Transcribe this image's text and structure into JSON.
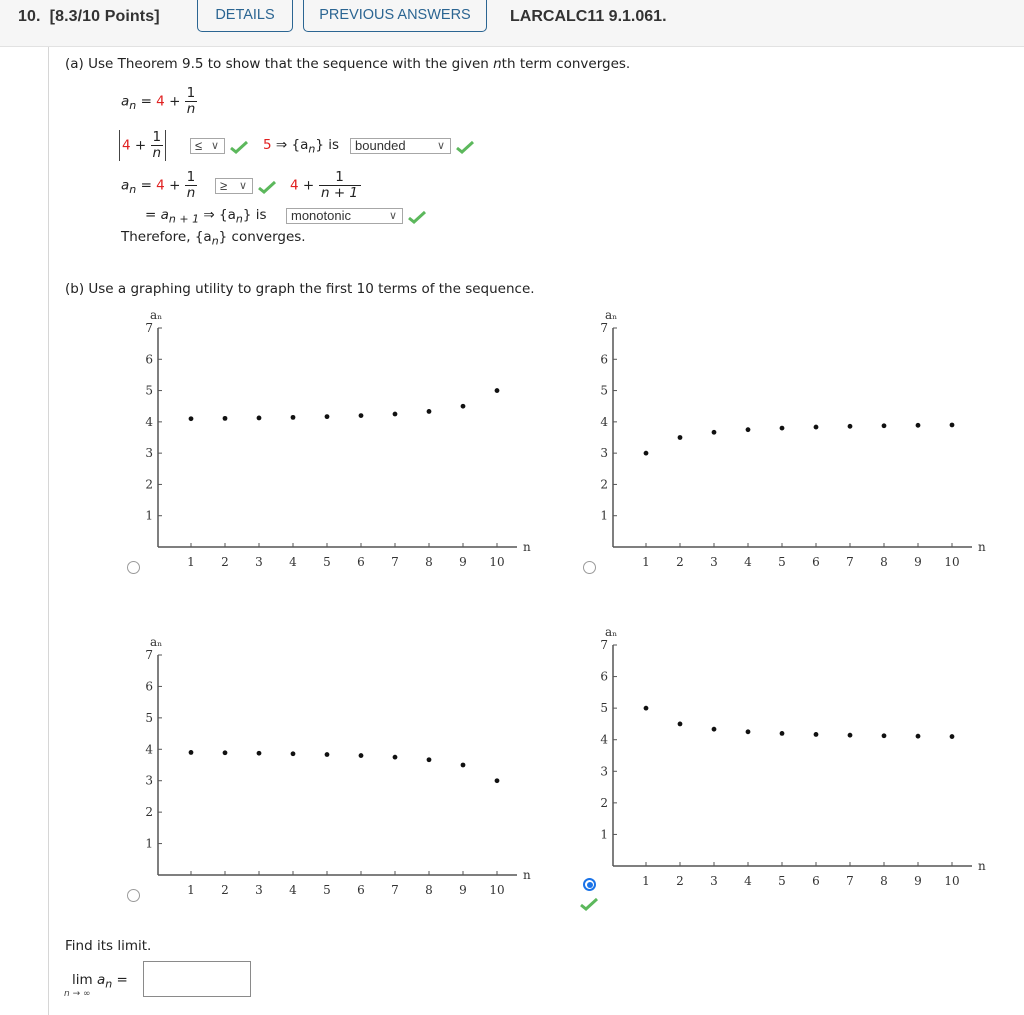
{
  "header": {
    "question_number": "10.",
    "points": "[8.3/10 Points]",
    "details_button": "DETAILS",
    "previous_answers_button": "PREVIOUS ANSWERS",
    "reference": "LARCALC11 9.1.061."
  },
  "part_a": {
    "prompt_pre": "(a) Use Theorem 9.5 to show that the sequence with the given ",
    "prompt_n": "n",
    "prompt_post": "th term converges.",
    "an_label": "a",
    "an_sub": "n",
    "equals": "=",
    "four": "4",
    "plus": "+",
    "one": "1",
    "n": "n",
    "n_plus_1": "n + 1",
    "bound_value": "5",
    "implies": "⇒",
    "set_open": "{a",
    "set_close": "}",
    "is": "is",
    "compare_select_1": "≤",
    "bounded_select": "bounded",
    "compare_select_2": "≥",
    "monotonic_select": "monotonic",
    "a_next_label": "= a",
    "a_next_sub": "n + 1",
    "therefore_pre": "Therefore, {a",
    "therefore_post": "} converges.",
    "correct_color": "#5cb85c",
    "highlight_color": "#e02020"
  },
  "part_b": {
    "prompt": "(b) Use a graphing utility to graph the first 10 terms of the sequence.",
    "selected_option": 4,
    "selected_correct": true
  },
  "limit": {
    "prompt": "Find its limit.",
    "lim": "lim",
    "lim_sub": "n → ∞",
    "an": "a",
    "an_sub": "n",
    "equals": "=",
    "answer_value": ""
  },
  "chart_data": [
    {
      "type": "scatter",
      "option": 1,
      "xlabel": "n",
      "ylabel": "aₙ",
      "x": [
        1,
        2,
        3,
        4,
        5,
        6,
        7,
        8,
        9,
        10
      ],
      "y": [
        4.1,
        4.111,
        4.125,
        4.143,
        4.167,
        4.2,
        4.25,
        4.333,
        4.5,
        5.0
      ],
      "xticks": [
        "1",
        "2",
        "3",
        "4",
        "5",
        "6",
        "7",
        "8",
        "9",
        "10"
      ],
      "yticks": [
        "1",
        "2",
        "3",
        "4",
        "5",
        "6",
        "7"
      ],
      "xlim": [
        0,
        10.6
      ],
      "ylim": [
        0,
        7
      ],
      "grid": false
    },
    {
      "type": "scatter",
      "option": 2,
      "xlabel": "n",
      "ylabel": "aₙ",
      "x": [
        1,
        2,
        3,
        4,
        5,
        6,
        7,
        8,
        9,
        10
      ],
      "y": [
        3.0,
        3.5,
        3.667,
        3.75,
        3.8,
        3.833,
        3.857,
        3.875,
        3.889,
        3.9
      ],
      "xticks": [
        "1",
        "2",
        "3",
        "4",
        "5",
        "6",
        "7",
        "8",
        "9",
        "10"
      ],
      "yticks": [
        "1",
        "2",
        "3",
        "4",
        "5",
        "6",
        "7"
      ],
      "xlim": [
        0,
        10.6
      ],
      "ylim": [
        0,
        7
      ],
      "grid": false
    },
    {
      "type": "scatter",
      "option": 3,
      "xlabel": "n",
      "ylabel": "aₙ",
      "x": [
        1,
        2,
        3,
        4,
        5,
        6,
        7,
        8,
        9,
        10
      ],
      "y": [
        3.9,
        3.889,
        3.875,
        3.857,
        3.833,
        3.8,
        3.75,
        3.667,
        3.5,
        3.0
      ],
      "xticks": [
        "1",
        "2",
        "3",
        "4",
        "5",
        "6",
        "7",
        "8",
        "9",
        "10"
      ],
      "yticks": [
        "1",
        "2",
        "3",
        "4",
        "5",
        "6",
        "7"
      ],
      "xlim": [
        0,
        10.6
      ],
      "ylim": [
        0,
        7
      ],
      "grid": false
    },
    {
      "type": "scatter",
      "option": 4,
      "xlabel": "n",
      "ylabel": "aₙ",
      "x": [
        1,
        2,
        3,
        4,
        5,
        6,
        7,
        8,
        9,
        10
      ],
      "y": [
        5.0,
        4.5,
        4.333,
        4.25,
        4.2,
        4.167,
        4.143,
        4.125,
        4.111,
        4.1
      ],
      "xticks": [
        "1",
        "2",
        "3",
        "4",
        "5",
        "6",
        "7",
        "8",
        "9",
        "10"
      ],
      "yticks": [
        "1",
        "2",
        "3",
        "4",
        "5",
        "6",
        "7"
      ],
      "xlim": [
        0,
        10.6
      ],
      "ylim": [
        0,
        7
      ],
      "grid": false
    }
  ]
}
